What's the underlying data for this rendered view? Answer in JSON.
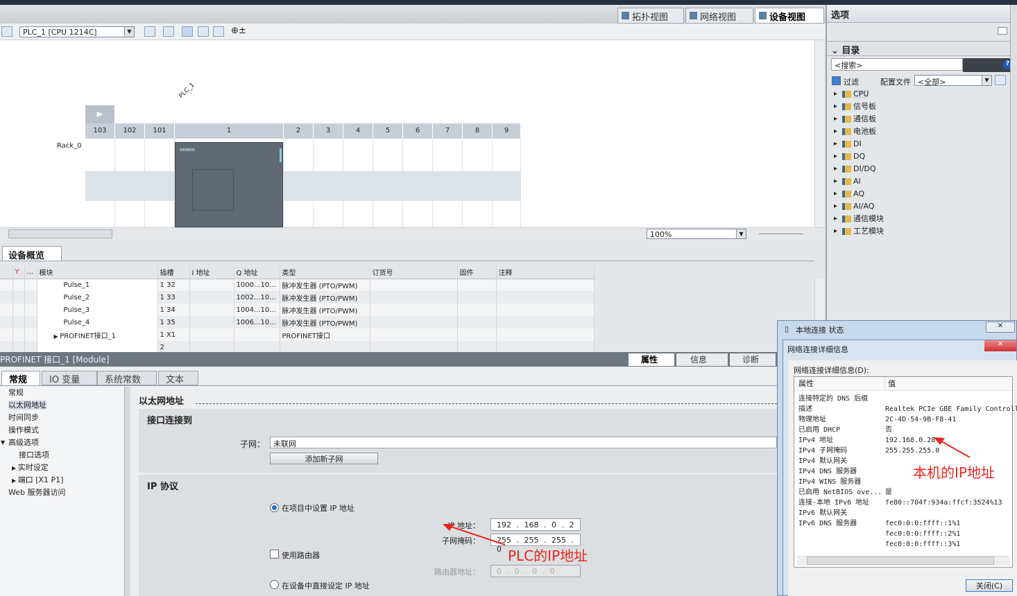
{
  "view_tabs": [
    {
      "label": "拓扑视图"
    },
    {
      "label": "网络视图"
    },
    {
      "label": "设备视图",
      "active": true
    }
  ],
  "toolbar": {
    "device_select": "PLC_1 [CPU 1214C]"
  },
  "canvas": {
    "plc_label": "PLC_1",
    "rack_label": "Rack_0",
    "slots": [
      "103",
      "102",
      "101",
      "1",
      "2",
      "3",
      "4",
      "5",
      "6",
      "7",
      "8",
      "9"
    ],
    "zoom": "100%",
    "cpu_brand": "SIEMENS"
  },
  "overview": {
    "tab": "设备概览",
    "columns": [
      "模块",
      "插槽",
      "I 地址",
      "Q 地址",
      "类型",
      "订货号",
      "固件",
      "注释"
    ],
    "rows": [
      {
        "module": "Pulse_1",
        "slot": "1 32",
        "i": "",
        "q": "1000...10...",
        "type": "脉冲发生器 (PTO/PWM)"
      },
      {
        "module": "Pulse_2",
        "slot": "1 33",
        "i": "",
        "q": "1002...10...",
        "type": "脉冲发生器 (PTO/PWM)"
      },
      {
        "module": "Pulse_3",
        "slot": "1 34",
        "i": "",
        "q": "1004...10...",
        "type": "脉冲发生器 (PTO/PWM)"
      },
      {
        "module": "Pulse_4",
        "slot": "1 35",
        "i": "",
        "q": "1006...10...",
        "type": "脉冲发生器 (PTO/PWM)"
      },
      {
        "module": "PROFINET接口_1",
        "slot": "1 X1",
        "i": "",
        "q": "",
        "type": "PROFINET接口"
      },
      {
        "module": "",
        "slot": "2",
        "i": "",
        "q": "",
        "type": ""
      }
    ]
  },
  "properties": {
    "title": "PROFINET 接口_1 [Module]",
    "right_tabs": [
      "属性",
      "信息",
      "诊断"
    ],
    "tabs": [
      "常规",
      "IO 变量",
      "系统常数",
      "文本"
    ],
    "nav": [
      "常规",
      "以太网地址",
      "时间同步",
      "操作模式",
      "高级选项",
      "接口选项",
      "实时设定",
      "端口 [X1 P1]",
      "Web 服务器访问"
    ],
    "section_title": "以太网地址",
    "iface_title": "接口连接到",
    "subnet_label": "子网：",
    "subnet_value": "未联网",
    "add_subnet": "添加新子网",
    "ip_title": "IP 协议",
    "opt_project": "在项目中设置 IP 地址",
    "ip_label": "IP 地址：",
    "ip_value": "192 . 168 . 0 . 2",
    "mask_label": "子网掩码：",
    "mask_value": "255 . 255 . 255 . 0",
    "use_router": "使用路由器",
    "router_label": "路由器地址：",
    "router_value": "0 . 0 . 0 . 0",
    "opt_device": "在设备中直接设定 IP 地址",
    "annotation": "PLC的IP地址"
  },
  "right_panel": {
    "options": "选项",
    "catalog": "目录",
    "search_placeholder": "<搜索>",
    "filter": "过滤",
    "profile_label": "配置文件",
    "profile_value": "<全部>",
    "tree": [
      "CPU",
      "信号板",
      "通信板",
      "电池板",
      "DI",
      "DQ",
      "DI/DQ",
      "AI",
      "AQ",
      "AI/AQ",
      "通信模块",
      "工艺模块"
    ]
  },
  "dialog": {
    "outer_title": "本地连接 状态",
    "title": "网络连接详细信息",
    "caption": "网络连接详细信息(D):",
    "col_prop": "属性",
    "col_val": "值",
    "rows": [
      [
        "连接特定的 DNS 后缀",
        ""
      ],
      [
        "描述",
        "Realtek PCIe GBE Family Controlle"
      ],
      [
        "物理地址",
        "2C-4D-54-9B-F8-41"
      ],
      [
        "已启用 DHCP",
        "否"
      ],
      [
        "IPv4 地址",
        "192.168.0.28"
      ],
      [
        "IPv4 子网掩码",
        "255.255.255.0"
      ],
      [
        "IPv4 默认网关",
        ""
      ],
      [
        "IPv4 DNS 服务器",
        ""
      ],
      [
        "IPv4 WINS 服务器",
        ""
      ],
      [
        "已启用 NetBIOS ove...",
        "是"
      ],
      [
        "连接-本地 IPv6 地址",
        "fe80::704f:934a:ffcf:3524%13"
      ],
      [
        "IPv6 默认网关",
        ""
      ],
      [
        "IPv6 DNS 服务器",
        "fec0:0:0:ffff::1%1"
      ],
      [
        "",
        "fec0:0:0:ffff::2%1"
      ],
      [
        "",
        "fec0:0:0:ffff::3%1"
      ]
    ],
    "close": "关闭(C)",
    "annotation": "本机的IP地址"
  },
  "colors": {
    "annotation": "#e8261e",
    "header_dark": "#6e767e"
  }
}
